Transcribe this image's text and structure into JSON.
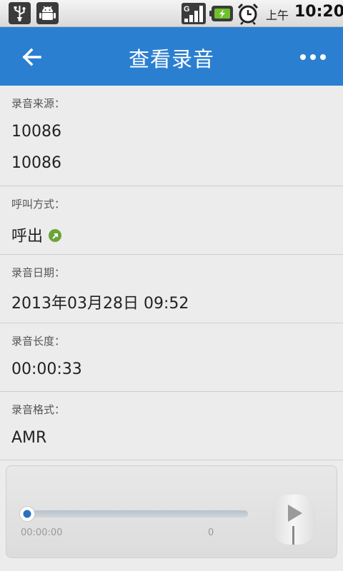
{
  "status_bar": {
    "ampm": "上午",
    "time": "10:20",
    "icons": [
      "usb-icon",
      "android-debug-icon",
      "signal-icon",
      "battery-charging-icon",
      "alarm-icon"
    ]
  },
  "action_bar": {
    "title": "查看录音",
    "back_icon": "arrow-left-icon",
    "more_icon": "overflow-dots-icon",
    "bg_color": "#2b7fd1"
  },
  "details": {
    "source_label": "录音来源：",
    "source_values": [
      "10086",
      "10086"
    ],
    "call_type_label": "呼叫方式：",
    "call_type_value": "呼出",
    "call_type_icon": "outgoing-call-icon",
    "date_label": "录音日期：",
    "date_value": "2013年03月28日 09:52",
    "length_label": "录音长度：",
    "length_value": "00:00:33",
    "format_label": "录音格式：",
    "format_value": "AMR"
  },
  "player": {
    "progress": 0,
    "current_time": "00:00:00",
    "end_time": "0",
    "play_icon": "play-icon",
    "accent_color": "#2b6fc0"
  }
}
